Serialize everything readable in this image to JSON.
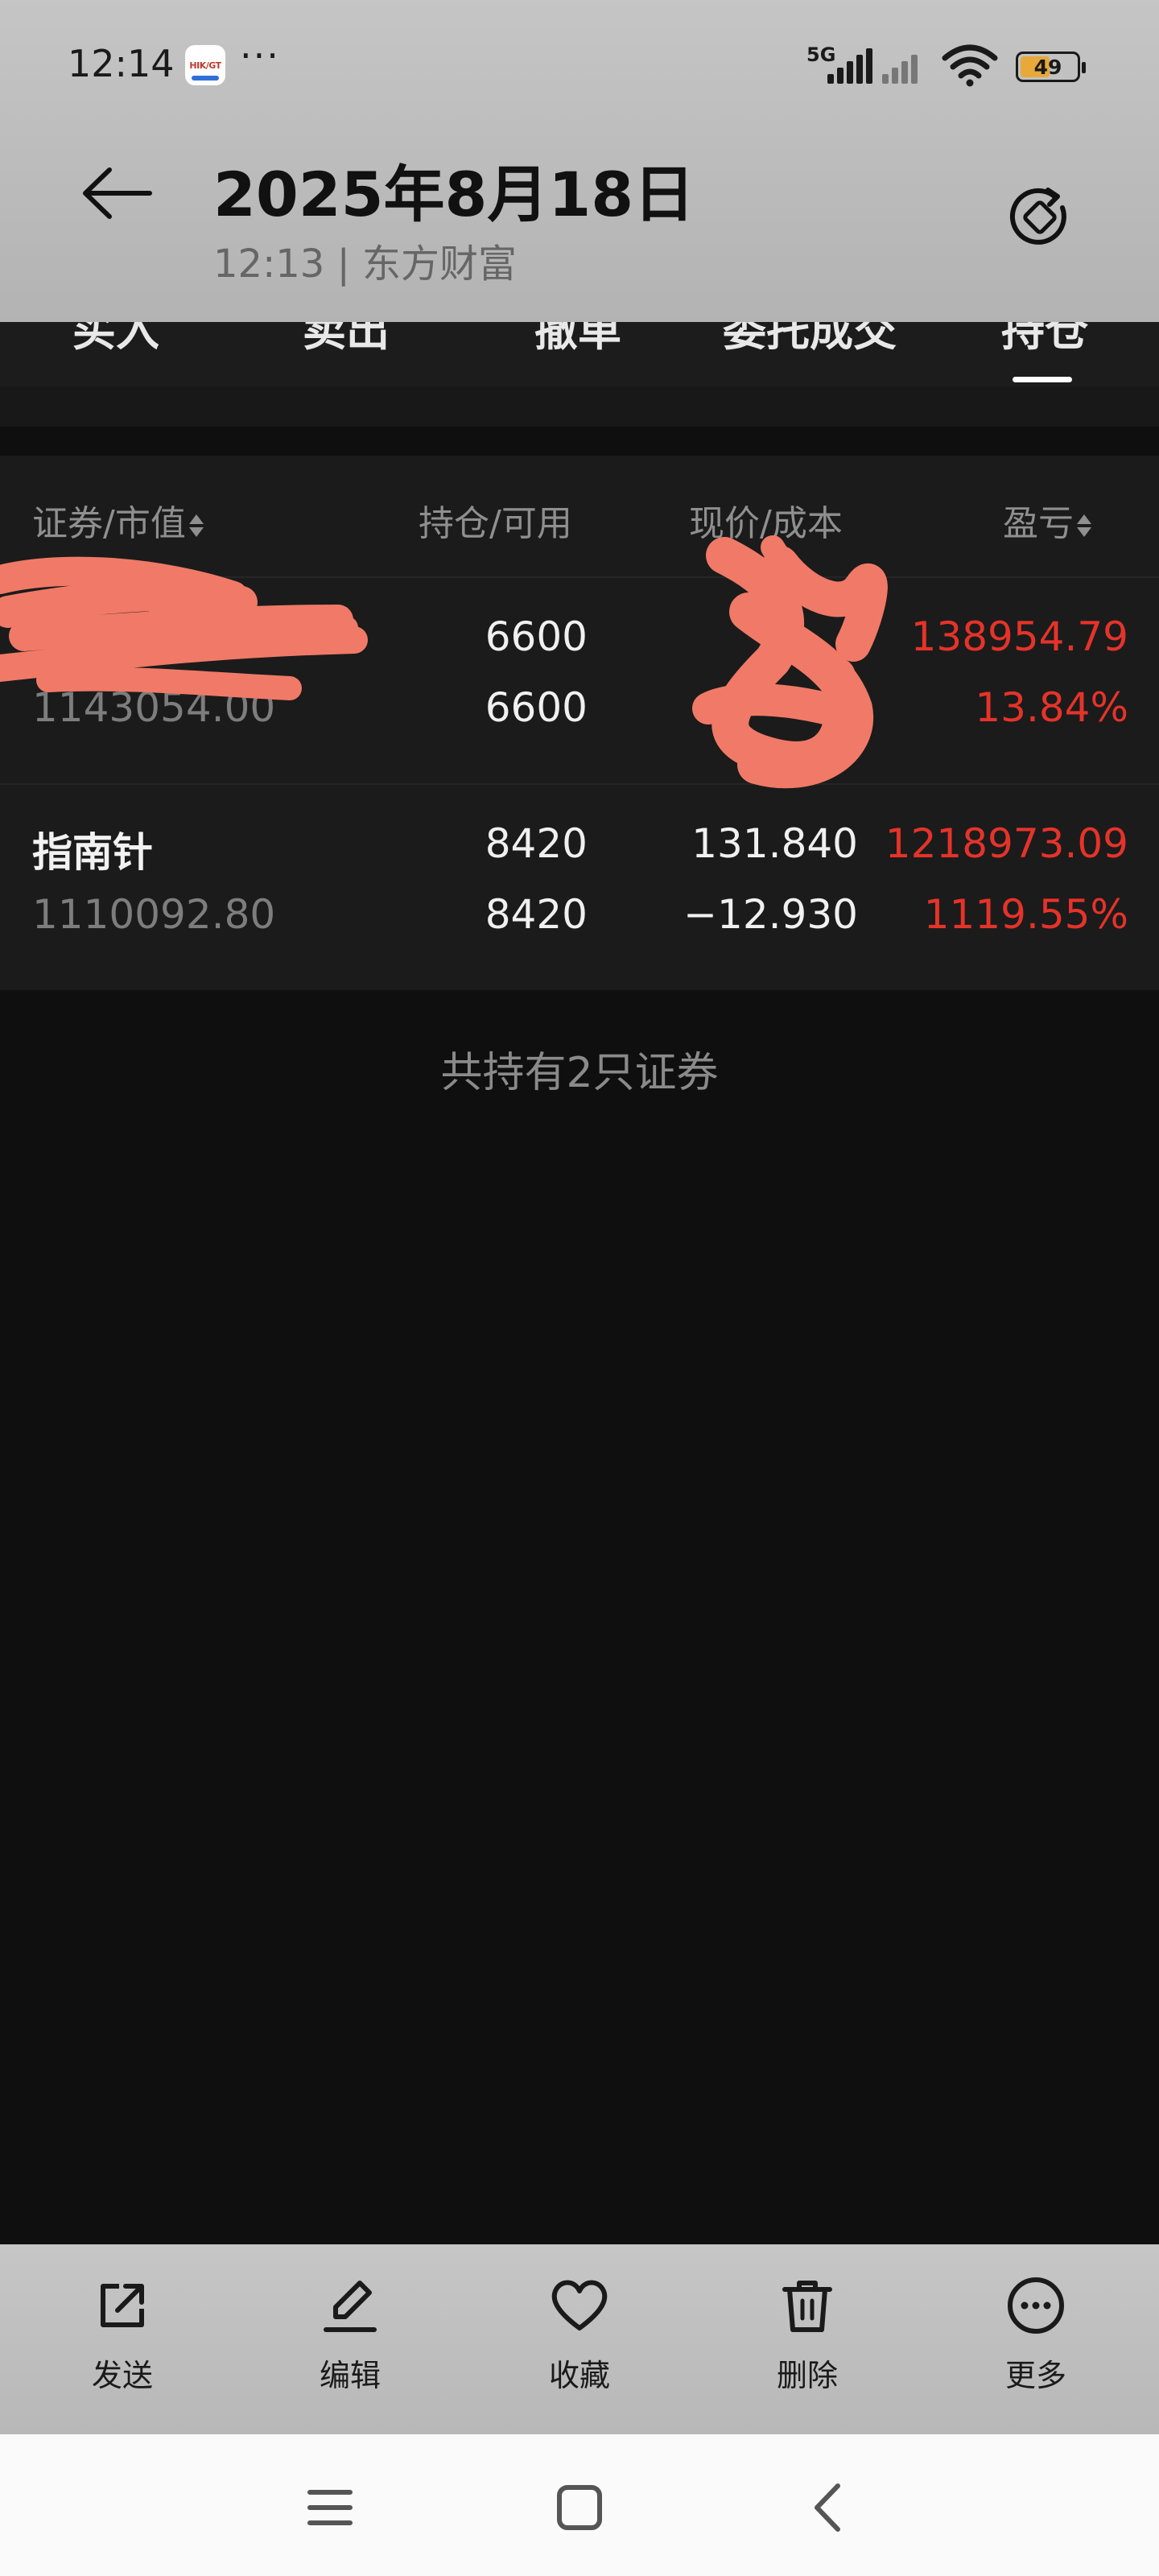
{
  "status_bar": {
    "time": "12:14",
    "more": "···",
    "network": "5G",
    "battery": "49",
    "notification_app_text": "HIK/GT"
  },
  "viewer": {
    "title": "2025年8月18日",
    "subtitle": "12:13 | 东方财富"
  },
  "tabs": [
    "买入",
    "卖出",
    "撤单",
    "委托成交",
    "持仓"
  ],
  "active_tab": "持仓",
  "table": {
    "headers": [
      "证券/市值",
      "持仓/可用",
      "现价/成本",
      "盈亏"
    ],
    "rows": [
      {
        "name": "",
        "market_value": "1143054.00",
        "position": "6600",
        "available": "6600",
        "price": "",
        "cost": "",
        "pnl": "138954.79",
        "pnl_pct": "13.84%"
      },
      {
        "name": "指南针",
        "market_value": "1110092.80",
        "position": "8420",
        "available": "8420",
        "price": "131.840",
        "cost": "−12.930",
        "pnl": "1218973.09",
        "pnl_pct": "1119.55%"
      }
    ],
    "summary": "共持有2只证券"
  },
  "actions": [
    {
      "label": "发送",
      "icon": "share-icon"
    },
    {
      "label": "编辑",
      "icon": "pencil-icon"
    },
    {
      "label": "收藏",
      "icon": "heart-icon"
    },
    {
      "label": "删除",
      "icon": "trash-icon"
    },
    {
      "label": "更多",
      "icon": "more-icon"
    }
  ],
  "colors": {
    "profit_red": "#e5332a",
    "page_bg": "#0f0f0f",
    "scribble": "#f07a67",
    "battery_fill": "#e6a93a"
  }
}
